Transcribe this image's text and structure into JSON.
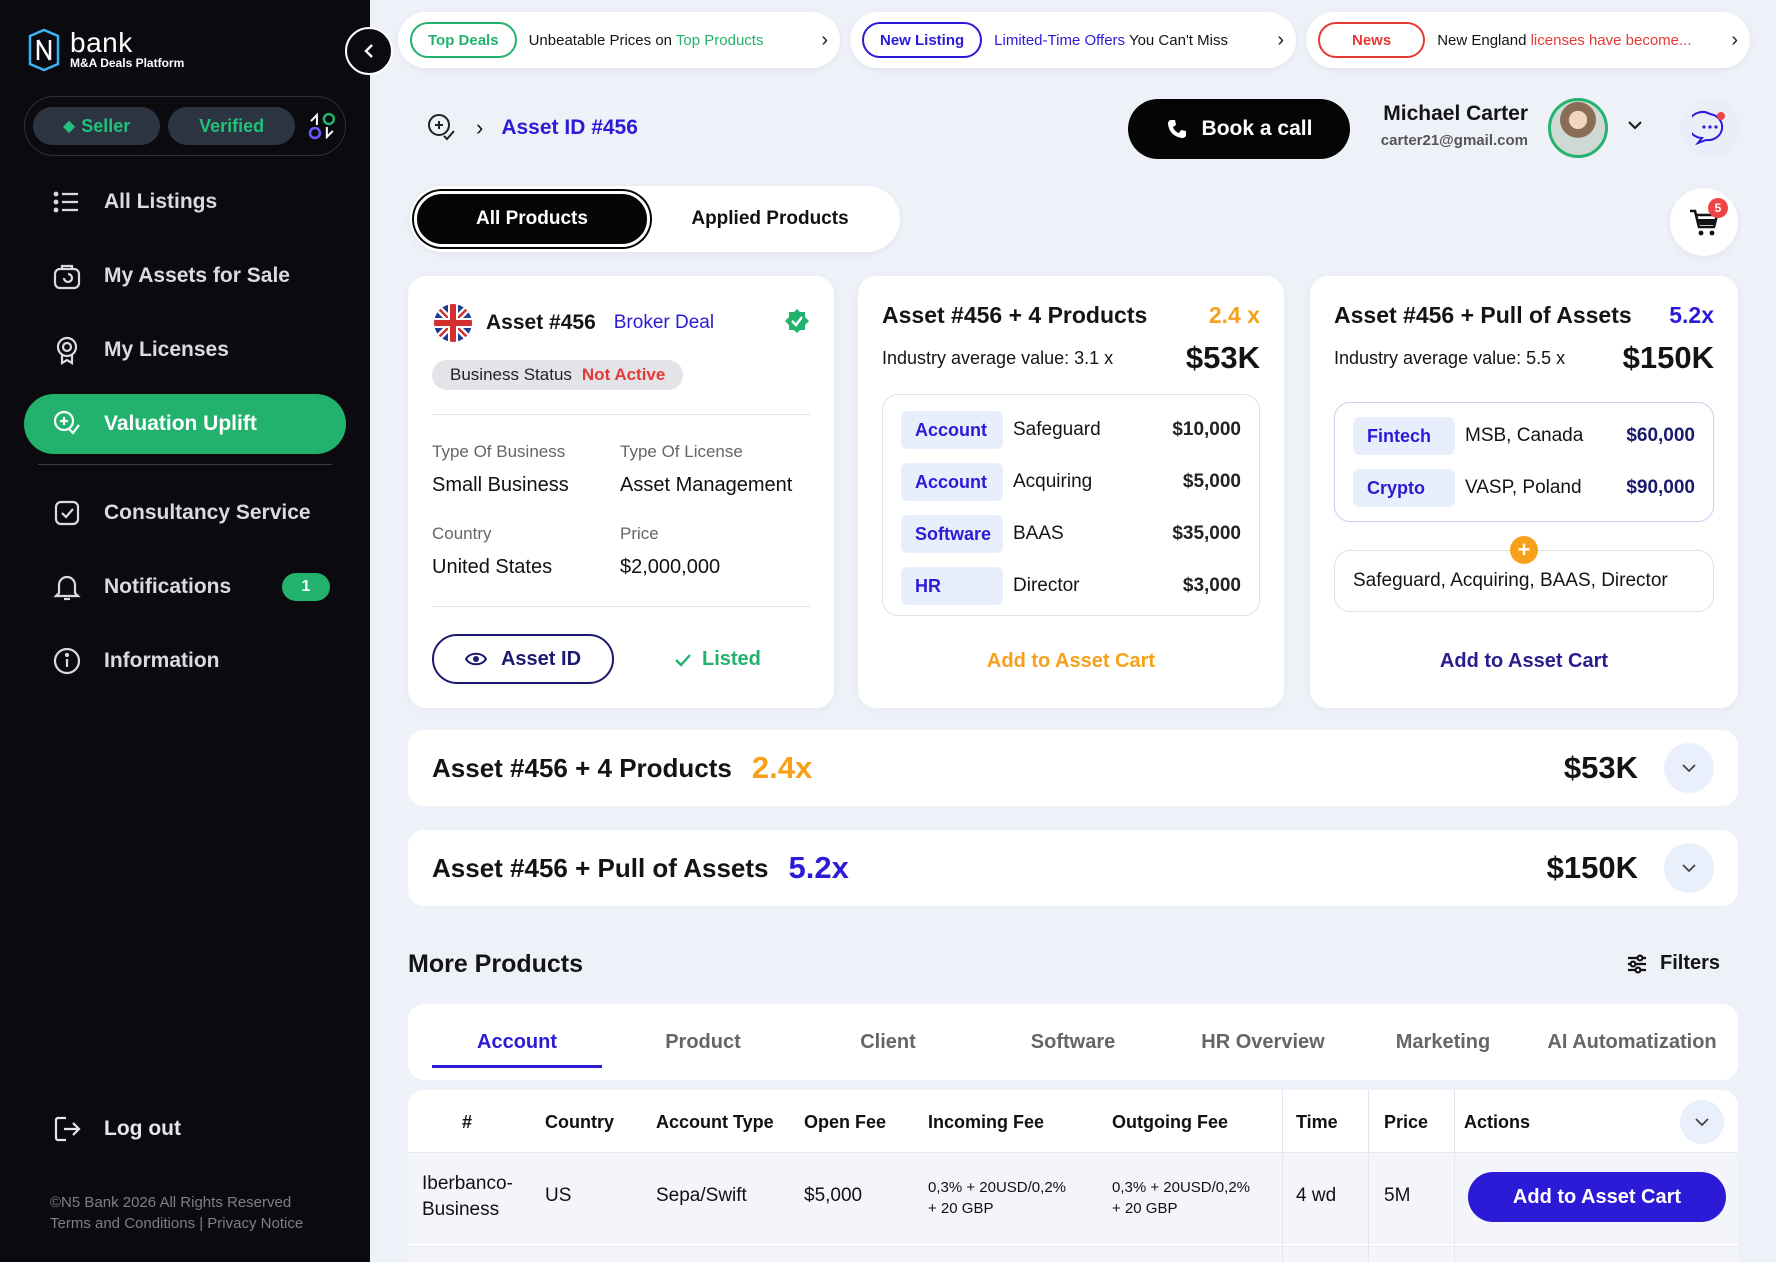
{
  "brand": {
    "name": "bank",
    "subtitle": "M&A Deals Platform"
  },
  "sidebar": {
    "role_seller": "Seller",
    "role_verified": "Verified",
    "items": [
      {
        "label": "All Listings",
        "icon": "list-icon"
      },
      {
        "label": "My Assets for Sale",
        "icon": "bag-icon"
      },
      {
        "label": "My Licenses",
        "icon": "award-icon"
      },
      {
        "label": "Valuation Uplift",
        "icon": "valuation-icon",
        "active": true
      },
      {
        "label": "Consultancy Service",
        "icon": "checkbox-icon"
      },
      {
        "label": "Notifications",
        "icon": "bell-icon",
        "badge": "1"
      },
      {
        "label": "Information",
        "icon": "info-icon"
      }
    ],
    "logout": "Log out",
    "footer_line1": "©N5 Bank 2026 All Rights Reserved",
    "footer_line2": "Terms and Conditions | Privacy Notice"
  },
  "ticker": [
    {
      "tag": "Top Deals",
      "text_a": "Unbeatable Prices on ",
      "text_b": "Top Products",
      "color": "#23b26d"
    },
    {
      "tag": "New Listing",
      "text_a": "Limited-Time Offers",
      "text_b": " You Can't Miss",
      "color": "#2c1bd6"
    },
    {
      "tag": "News",
      "text_a": "New England ",
      "text_b": "licenses have become...",
      "color": "#e53935"
    }
  ],
  "header": {
    "breadcrumb": "Asset ID #456",
    "book_call": "Book a call",
    "user_name": "Michael Carter",
    "user_email": "carter21@gmail.com"
  },
  "tabs": {
    "all": "All Products",
    "applied": "Applied Products"
  },
  "cart": {
    "count": "5"
  },
  "card1": {
    "title": "Asset #456",
    "deal": "Broker Deal",
    "status_label": "Business Status",
    "status_value": "Not Active",
    "type_business_label": "Type Of Business",
    "type_business_value": "Small Business",
    "type_license_label": "Type Of License",
    "type_license_value": "Asset Management",
    "country_label": "Country",
    "country_value": "United States",
    "price_label": "Price",
    "price_value": "$2,000,000",
    "asset_btn": "Asset ID",
    "listed": "Listed"
  },
  "card2": {
    "title": "Asset #456 + 4 Products",
    "mult": "2.4 x",
    "avg": "Industry average value: 3.1 x",
    "price": "$53K",
    "rows": [
      {
        "tag": "Account",
        "name": "Safeguard",
        "price": "$10,000"
      },
      {
        "tag": "Account",
        "name": "Acquiring",
        "price": "$5,000"
      },
      {
        "tag": "Software",
        "name": "BAAS",
        "price": "$35,000"
      },
      {
        "tag": "HR",
        "name": "Director",
        "price": "$3,000"
      }
    ],
    "cta": "Add to Asset Cart"
  },
  "card3": {
    "title": "Asset #456 + Pull of Assets",
    "mult": "5.2x",
    "avg": "Industry average value: 5.5 x",
    "price": "$150K",
    "rows": [
      {
        "tag": "Fintech",
        "name": "MSB, Canada",
        "price": "$60,000"
      },
      {
        "tag": "Crypto",
        "name": "VASP, Poland",
        "price": "$90,000"
      }
    ],
    "combined": "Safeguard, Acquiring, BAAS, Director",
    "cta": "Add to Asset Cart"
  },
  "accordion": [
    {
      "title": "Asset #456 + 4 Products",
      "mult": "2.4x",
      "price": "$53K",
      "color": "#f7a11b"
    },
    {
      "title": "Asset #456 + Pull of Assets",
      "mult": "5.2x",
      "price": "$150K",
      "color": "#2c1bd6"
    }
  ],
  "more": {
    "title": "More Products",
    "filters": "Filters"
  },
  "product_tabs": [
    "Account",
    "Product",
    "Client",
    "Software",
    "HR Overview",
    "Marketing",
    "AI Automatization"
  ],
  "table": {
    "headers": [
      "#",
      "Country",
      "Account Type",
      "Open Fee",
      "Incoming Fee",
      "Outgoing Fee",
      "Time",
      "Price",
      "Actions"
    ],
    "row": {
      "name_line1": "Iberbanco-",
      "name_line2": "Business",
      "country": "US",
      "account_type": "Sepa/Swift",
      "open_fee": "$5,000",
      "incoming_line1": "0,3% + 20USD/0,2%",
      "incoming_line2": "+ 20 GBP",
      "outgoing_line1": "0,3% + 20USD/0,2%",
      "outgoing_line2": "+ 20 GBP",
      "time": "4 wd",
      "price": "5M",
      "action": "Add to Asset Cart"
    }
  }
}
